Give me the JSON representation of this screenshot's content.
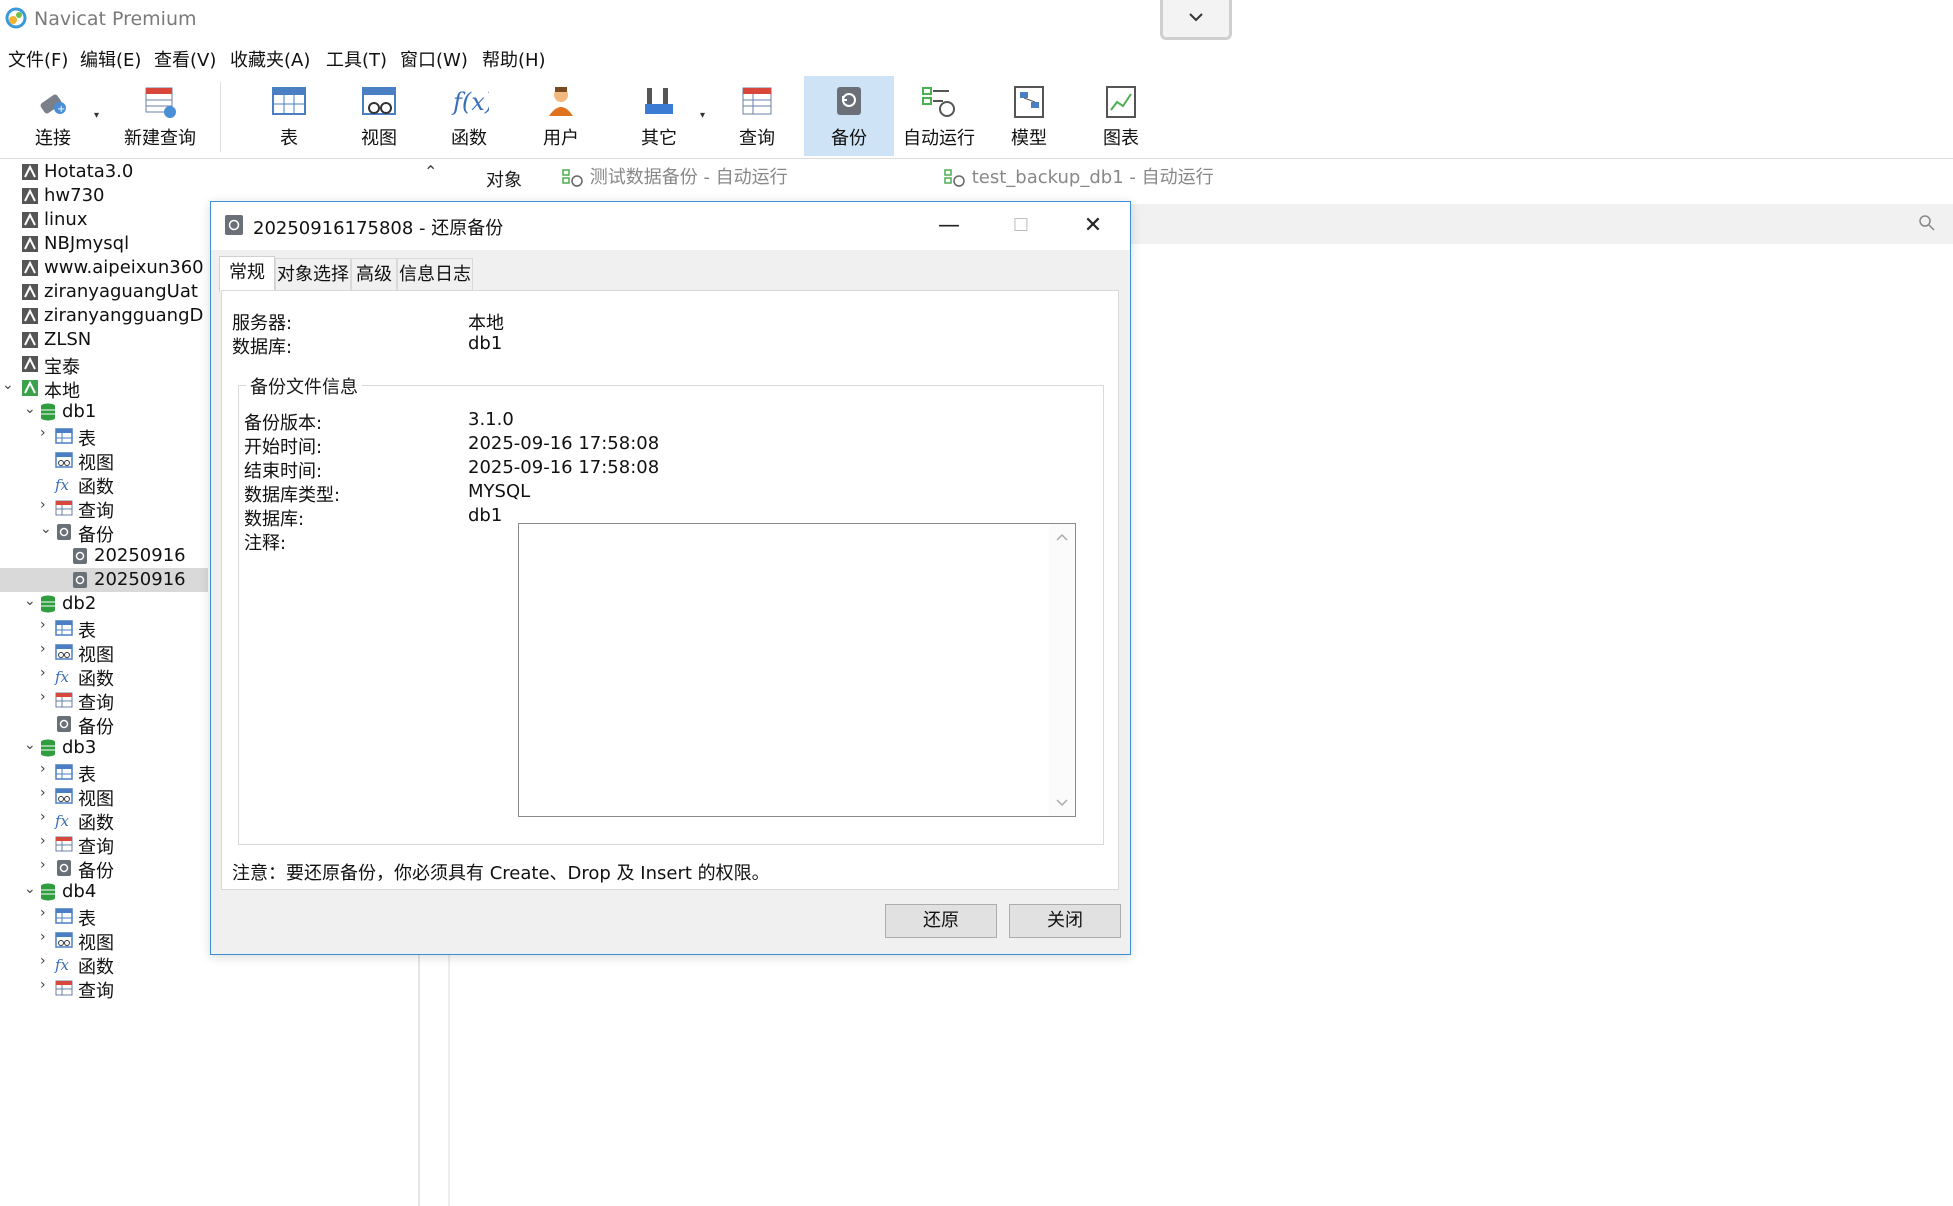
{
  "window": {
    "title": "Navicat Premium"
  },
  "menu": [
    "文件(F)",
    "编辑(E)",
    "查看(V)",
    "收藏夹(A)",
    "工具(T)",
    "窗口(W)",
    "帮助(H)"
  ],
  "toolbar": {
    "connect": "连接",
    "new_query": "新建查询",
    "table": "表",
    "view": "视图",
    "function": "函数",
    "user": "用户",
    "other": "其它",
    "query": "查询",
    "backup": "备份",
    "auto_run": "自动运行",
    "model": "模型",
    "chart": "图表"
  },
  "sidebar": {
    "items": [
      {
        "label": "Hotata3.0"
      },
      {
        "label": "hw730"
      },
      {
        "label": "linux"
      },
      {
        "label": "NBJmysql"
      },
      {
        "label": "www.aipeixun360"
      },
      {
        "label": "ziranyaguangUat"
      },
      {
        "label": "ziranyangguangD"
      },
      {
        "label": "ZLSN"
      },
      {
        "label": "宝泰"
      },
      {
        "label": "本地"
      },
      {
        "label": "db1"
      },
      {
        "label": "表"
      },
      {
        "label": "视图"
      },
      {
        "label": "函数"
      },
      {
        "label": "查询"
      },
      {
        "label": "备份"
      },
      {
        "label": "20250916"
      },
      {
        "label": "20250916"
      },
      {
        "label": "db2"
      },
      {
        "label": "表"
      },
      {
        "label": "视图"
      },
      {
        "label": "函数"
      },
      {
        "label": "查询"
      },
      {
        "label": "备份"
      },
      {
        "label": "db3"
      },
      {
        "label": "表"
      },
      {
        "label": "视图"
      },
      {
        "label": "函数"
      },
      {
        "label": "查询"
      },
      {
        "label": "备份"
      },
      {
        "label": "db4"
      },
      {
        "label": "表"
      },
      {
        "label": "视图"
      },
      {
        "label": "函数"
      },
      {
        "label": "查询"
      }
    ]
  },
  "main_tabs": {
    "objects": "对象",
    "tab1": "测试数据备份 - 自动运行",
    "tab2": "test_backup_db1 - 自动运行"
  },
  "dialog": {
    "title": "20250916175808 - 还原备份",
    "tabs": [
      "常规",
      "对象选择",
      "高级",
      "信息日志"
    ],
    "server_label": "服务器:",
    "server_value": "本地",
    "database_label": "数据库:",
    "database_value": "db1",
    "group_title": "备份文件信息",
    "backup_version_label": "备份版本:",
    "backup_version_value": "3.1.0",
    "start_time_label": "开始时间:",
    "start_time_value": "2025-09-16 17:58:08",
    "end_time_label": "结束时间:",
    "end_time_value": "2025-09-16 17:58:08",
    "db_type_label": "数据库类型:",
    "db_type_value": "MYSQL",
    "db_label2": "数据库:",
    "db_value2": "db1",
    "notes_label": "注释:",
    "notice": "注意：要还原备份，你必须具有 Create、Drop 及 Insert 的权限。",
    "restore_button": "还原",
    "close_button": "关闭"
  },
  "colors": {
    "accent": "#3c8ed6",
    "active_tool": "#cfe3f7",
    "db_green": "#2e9e3e"
  }
}
